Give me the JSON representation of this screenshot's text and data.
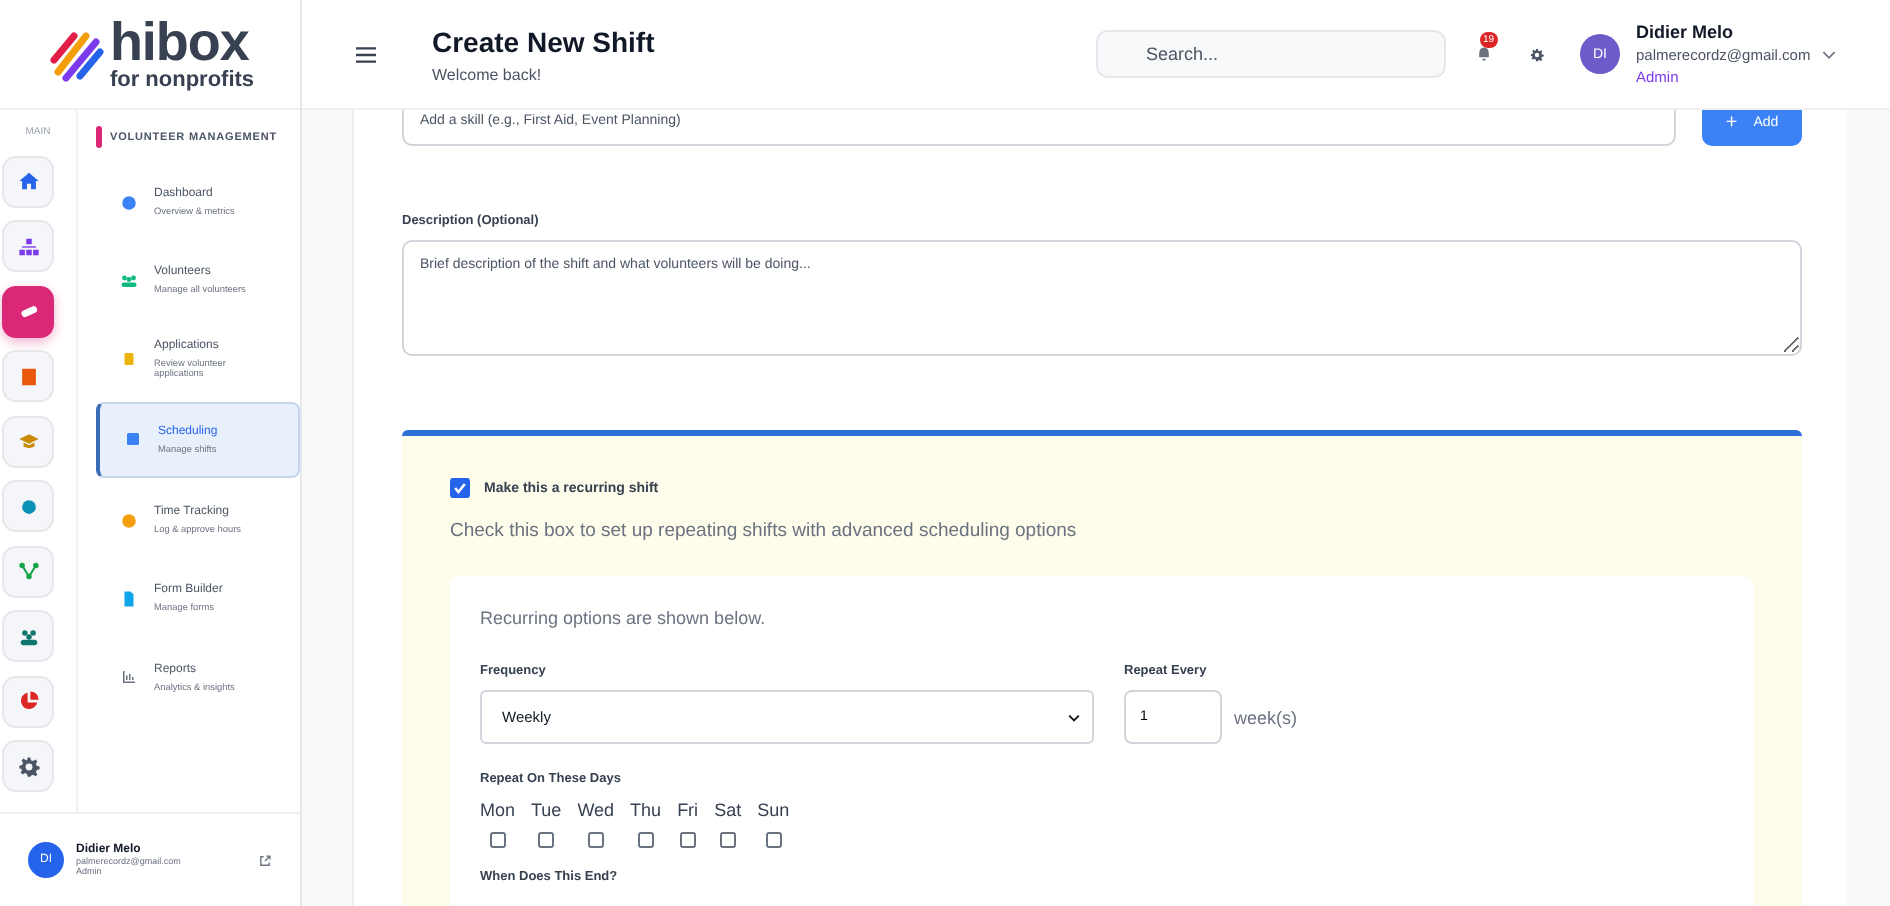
{
  "logo": {
    "name": "hibox",
    "tagline": "for nonprofits"
  },
  "rail": {
    "label": "MAIN",
    "items": [
      {
        "selected": false
      },
      {
        "selected": false
      },
      {
        "selected": true
      },
      {
        "selected": false
      },
      {
        "selected": false
      },
      {
        "selected": false
      },
      {
        "selected": false
      },
      {
        "selected": false
      },
      {
        "selected": false
      },
      {
        "selected": false
      }
    ]
  },
  "nav": {
    "section": "VOLUNTEER MANAGEMENT",
    "items": [
      {
        "title": "Dashboard",
        "subtitle": "Overview & metrics",
        "selected": false
      },
      {
        "title": "Volunteers",
        "subtitle": "Manage all volunteers",
        "selected": false
      },
      {
        "title": "Applications",
        "subtitle": "Review volunteer applications",
        "selected": false
      },
      {
        "title": "Scheduling",
        "subtitle": "Manage shifts",
        "selected": true
      },
      {
        "title": "Time Tracking",
        "subtitle": "Log & approve hours",
        "selected": false
      },
      {
        "title": "Form Builder",
        "subtitle": "Manage forms",
        "selected": false
      },
      {
        "title": "Reports",
        "subtitle": "Analytics & insights",
        "selected": false
      }
    ]
  },
  "sidebar_user": {
    "initials": "DI",
    "name": "Didier Melo",
    "email": "palmerecordz@gmail.com",
    "role": "Admin"
  },
  "header": {
    "title": "Create New Shift",
    "subtitle": "Welcome back!",
    "search_placeholder": "Search...",
    "notification_count": "19",
    "user": {
      "initials": "DI",
      "name": "Didier Melo",
      "email": "palmerecordz@gmail.com",
      "role": "Admin"
    }
  },
  "skills": {
    "placeholder": "Add a skill (e.g., First Aid, Event Planning)",
    "button": "Add",
    "button_icon": "+"
  },
  "description": {
    "label": "Description (Optional)",
    "placeholder": "Brief description of the shift and what volunteers will be doing..."
  },
  "recurring": {
    "label": "Make this a recurring shift",
    "checked": true,
    "help": "Check this box to set up repeating shifts with advanced scheduling options",
    "note": "Recurring options are shown below.",
    "frequency": {
      "label": "Frequency",
      "value": "Weekly"
    },
    "repeat_every": {
      "label": "Repeat Every",
      "value": "1",
      "unit": "week(s)"
    },
    "days_label": "Repeat On These Days",
    "days": [
      {
        "label": "Mon",
        "checked": false
      },
      {
        "label": "Tue",
        "checked": false
      },
      {
        "label": "Wed",
        "checked": false
      },
      {
        "label": "Thu",
        "checked": false
      },
      {
        "label": "Fri",
        "checked": false
      },
      {
        "label": "Sat",
        "checked": false
      },
      {
        "label": "Sun",
        "checked": false
      }
    ],
    "end_label": "When Does This End?"
  }
}
